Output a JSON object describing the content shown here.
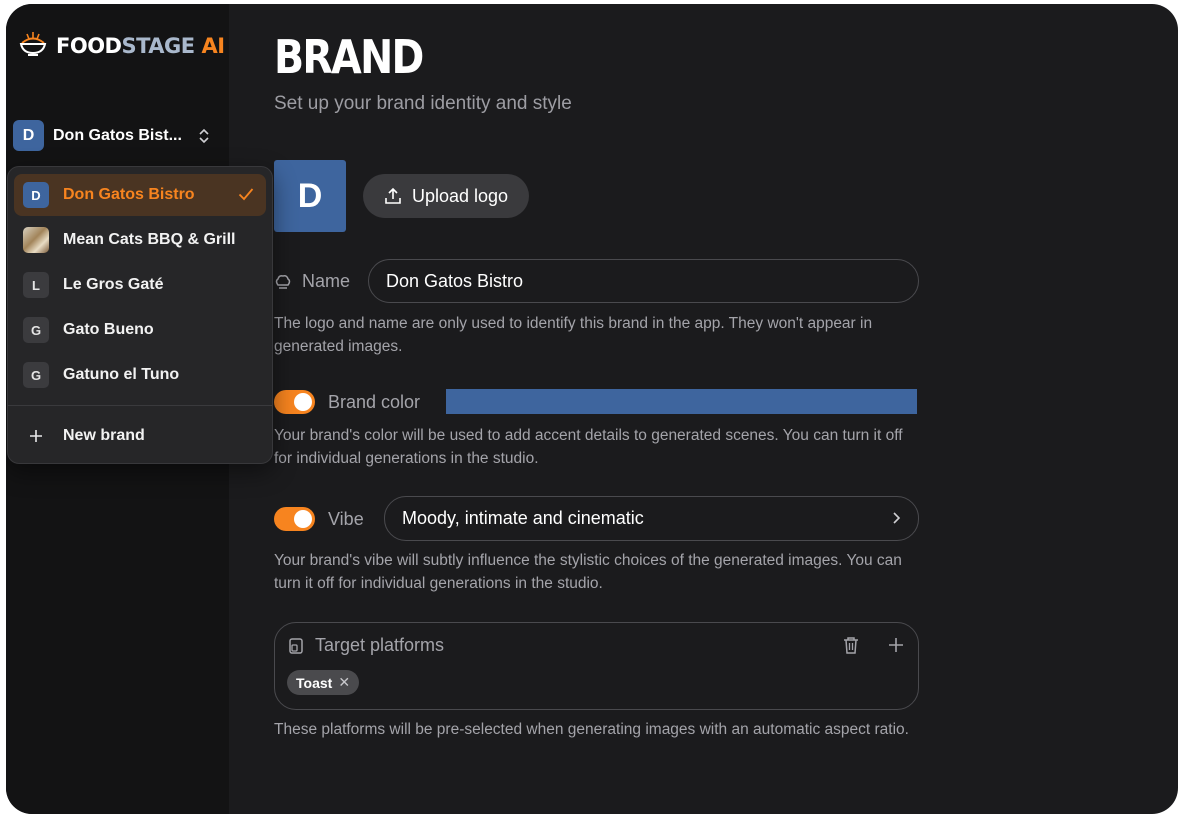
{
  "app": {
    "logo_food": "FOOD",
    "logo_stage": "STAGE",
    "logo_ai": " AI"
  },
  "sidebar": {
    "current_brand": {
      "initial": "D",
      "name": "Don Gatos Bist..."
    },
    "dropdown": {
      "items": [
        {
          "initial": "D",
          "label": "Don Gatos Bistro",
          "selected": true
        },
        {
          "initial": "",
          "label": "Mean Cats BBQ & Grill",
          "selected": false
        },
        {
          "initial": "L",
          "label": "Le Gros Gaté",
          "selected": false
        },
        {
          "initial": "G",
          "label": "Gato Bueno",
          "selected": false
        },
        {
          "initial": "G",
          "label": "Gatuno el Tuno",
          "selected": false
        }
      ],
      "new_brand_label": "New brand"
    }
  },
  "main": {
    "title": "BRAND",
    "subtitle": "Set up your brand identity and style",
    "logo_initial": "D",
    "upload_label": "Upload logo",
    "name_label": "Name",
    "name_value": "Don Gatos Bistro",
    "name_help": "The logo and name are only used to identify this brand in the app. They won't appear in generated images.",
    "brand_color_label": "Brand color",
    "brand_color_enabled": true,
    "brand_color_help": "Your brand's color will be used to add accent details to generated scenes. You can turn it off for individual generations in the studio.",
    "vibe_label": "Vibe",
    "vibe_enabled": true,
    "vibe_value": "Moody, intimate and cinematic",
    "vibe_help": "Your brand's vibe will subtly influence the stylistic choices of the generated images. You can turn it off for individual generations in the studio.",
    "platforms_label": "Target platforms",
    "platforms": [
      "Toast"
    ],
    "platforms_help": "These platforms will be pre-selected when generating images with an automatic aspect ratio."
  },
  "colors": {
    "accent": "#f7841f",
    "brand": "#3e659e",
    "background": "#1b1b1d",
    "sidebar": "#131314"
  }
}
